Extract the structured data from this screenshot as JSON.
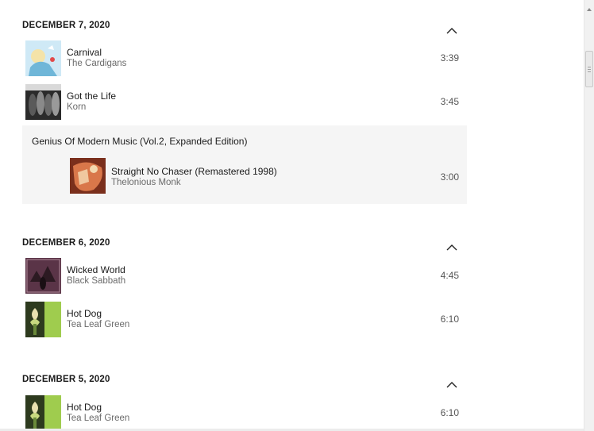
{
  "sections": [
    {
      "date": "DECEMBER 7, 2020",
      "tracks": [
        {
          "title": "Carnival",
          "artist": "The Cardigans",
          "duration": "3:39"
        },
        {
          "title": "Got the Life",
          "artist": "Korn",
          "duration": "3:45"
        }
      ],
      "album_group": {
        "album": "Genius Of Modern Music (Vol.2, Expanded Edition)",
        "track": {
          "title": "Straight No Chaser (Remastered 1998)",
          "artist": "Thelonious Monk",
          "duration": "3:00"
        }
      }
    },
    {
      "date": "DECEMBER 6, 2020",
      "tracks": [
        {
          "title": "Wicked World",
          "artist": "Black Sabbath",
          "duration": "4:45"
        },
        {
          "title": "Hot Dog",
          "artist": "Tea Leaf Green",
          "duration": "6:10"
        }
      ]
    },
    {
      "date": "DECEMBER 5, 2020",
      "tracks": [
        {
          "title": "Hot Dog",
          "artist": "Tea Leaf Green",
          "duration": "6:10"
        }
      ]
    }
  ],
  "icons": {
    "collapse": "chevron-up-icon",
    "scroll_up": "scroll-up-arrow-icon"
  },
  "colors": {
    "album_group_bg": "#f5f5f5",
    "artist_text": "#6b6b6b"
  }
}
